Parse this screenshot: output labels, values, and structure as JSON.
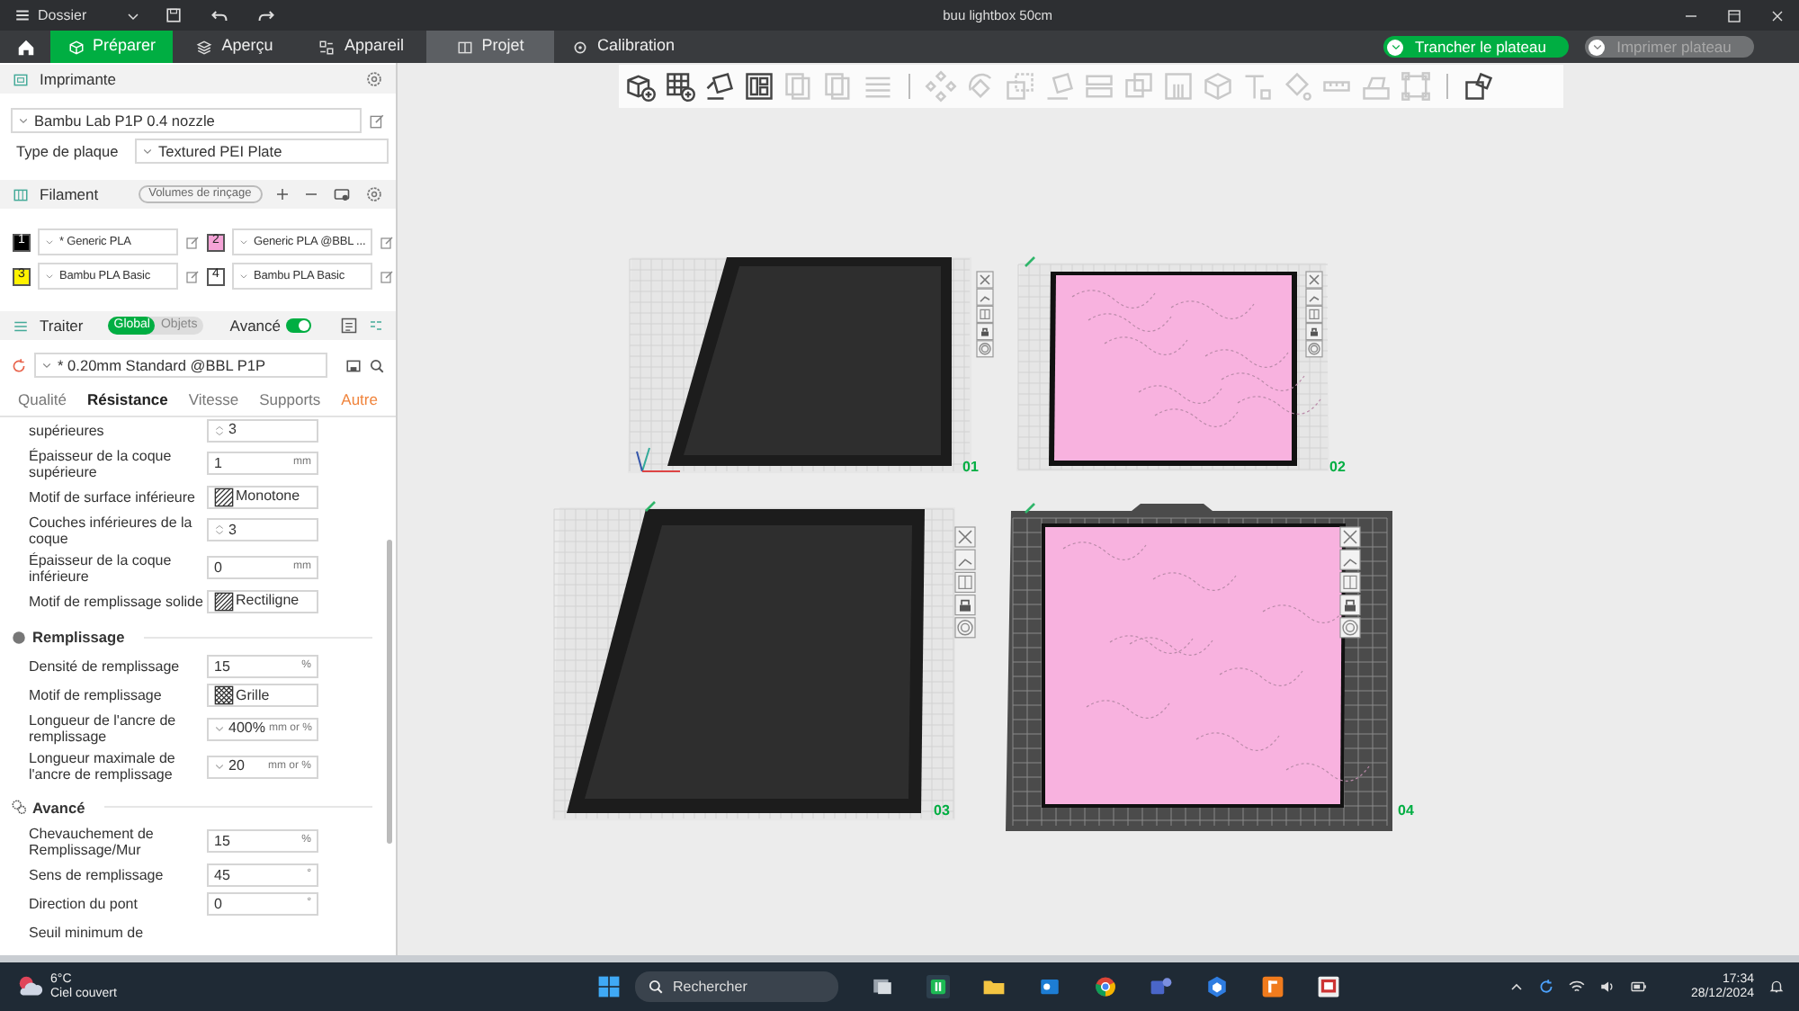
{
  "window": {
    "menu": "Dossier",
    "title": "buu lightbox 50cm"
  },
  "tabs": [
    {
      "label": "Préparer",
      "selected": true,
      "hovered": false
    },
    {
      "label": "Aperçu",
      "selected": false,
      "hovered": false
    },
    {
      "label": "Appareil",
      "selected": false,
      "hovered": false
    },
    {
      "label": "Projet",
      "selected": false,
      "hovered": true
    },
    {
      "label": "Calibration",
      "selected": false,
      "hovered": false
    }
  ],
  "actions": [
    {
      "label": "Trancher le plateau",
      "disabled": false
    },
    {
      "label": "Imprimer plateau",
      "disabled": true
    }
  ],
  "printer": {
    "title": "Imprimante",
    "model": "Bambu Lab P1P 0.4 nozzle",
    "plate_type_label": "Type de plaque",
    "plate_type": "Textured PEI Plate"
  },
  "filament": {
    "title": "Filament",
    "flush_button": "Volumes de rinçage",
    "items": [
      {
        "number": "1",
        "color": "#000000",
        "name": "* Generic PLA"
      },
      {
        "number": "2",
        "color": "#f5a3d7",
        "name": "Generic PLA @BBL ..."
      },
      {
        "number": "3",
        "color": "#fff200",
        "name": "Bambu PLA Basic"
      },
      {
        "number": "4",
        "color": "#ffffff",
        "name": "Bambu PLA Basic"
      }
    ]
  },
  "process": {
    "title": "Traiter",
    "scopes": [
      {
        "label": "Global",
        "selected": true
      },
      {
        "label": "Objets",
        "selected": false
      }
    ],
    "advanced": {
      "label": "Avancé",
      "on": true
    },
    "preset": "* 0.20mm Standard @BBL P1P",
    "tabs": [
      {
        "label": "Qualité",
        "selected": false,
        "modified": false
      },
      {
        "label": "Résistance",
        "selected": true,
        "modified": false
      },
      {
        "label": "Vitesse",
        "selected": false,
        "modified": false
      },
      {
        "label": "Supports",
        "selected": false,
        "modified": false
      },
      {
        "label": "Autre",
        "selected": false,
        "modified": true
      }
    ]
  },
  "settings": [
    {
      "kind": "spin",
      "label": "supérieures",
      "value": "3"
    },
    {
      "kind": "number",
      "label": "Épaisseur de la coque supérieure",
      "value": "1",
      "unit": "mm"
    },
    {
      "kind": "pattern",
      "label": "Motif de surface inférieure",
      "value": "Monotone"
    },
    {
      "kind": "spin",
      "label": "Couches inférieures de la coque",
      "value": "3"
    },
    {
      "kind": "number",
      "label": "Épaisseur de la coque inférieure",
      "value": "0",
      "unit": "mm"
    },
    {
      "kind": "pattern",
      "label": "Motif de remplissage solide",
      "value": "Rectiligne"
    },
    {
      "kind": "section",
      "title": "Remplissage"
    },
    {
      "kind": "number",
      "label": "Densité de remplissage",
      "value": "15",
      "unit": "%"
    },
    {
      "kind": "pattern",
      "label": "Motif de remplissage",
      "value": "Grille"
    },
    {
      "kind": "combo",
      "label": "Longueur de l'ancre de remplissage",
      "value": "400%",
      "unit": "mm or %"
    },
    {
      "kind": "combo",
      "label": "Longueur maximale de l'ancre de remplissage",
      "value": "20",
      "unit": "mm or %"
    },
    {
      "kind": "section",
      "title": "Avancé"
    },
    {
      "kind": "number",
      "label": "Chevauchement de Remplissage/Mur",
      "value": "15",
      "unit": "%"
    },
    {
      "kind": "number",
      "label": "Sens de remplissage",
      "value": "45",
      "unit": "°"
    },
    {
      "kind": "number",
      "label": "Direction du pont",
      "value": "0",
      "unit": "°"
    },
    {
      "kind": "label",
      "label": "Seuil minimum de"
    }
  ],
  "toolbar": [
    {
      "kind": "tool",
      "disabled": false
    },
    {
      "kind": "tool",
      "disabled": false
    },
    {
      "kind": "tool",
      "disabled": false
    },
    {
      "kind": "tool",
      "disabled": false
    },
    {
      "kind": "tool",
      "disabled": true
    },
    {
      "kind": "tool",
      "disabled": true
    },
    {
      "kind": "tool",
      "disabled": true
    },
    {
      "kind": "separator"
    },
    {
      "kind": "tool",
      "disabled": true
    },
    {
      "kind": "tool",
      "disabled": true
    },
    {
      "kind": "tool",
      "disabled": true
    },
    {
      "kind": "tool",
      "disabled": true
    },
    {
      "kind": "tool",
      "disabled": true
    },
    {
      "kind": "tool",
      "disabled": true
    },
    {
      "kind": "tool",
      "disabled": true
    },
    {
      "kind": "tool",
      "disabled": true
    },
    {
      "kind": "tool",
      "disabled": true
    },
    {
      "kind": "tool",
      "disabled": true
    },
    {
      "kind": "tool",
      "disabled": true
    },
    {
      "kind": "tool",
      "disabled": true
    },
    {
      "kind": "tool",
      "disabled": true
    },
    {
      "kind": "separator"
    },
    {
      "kind": "tool",
      "disabled": false
    }
  ],
  "plates": [
    {
      "number": "01",
      "kind": "tray",
      "selected": false
    },
    {
      "number": "02",
      "kind": "panel",
      "selected": false
    },
    {
      "number": "03",
      "kind": "tray",
      "selected": false
    },
    {
      "number": "04",
      "kind": "panel",
      "selected": true
    }
  ],
  "taskbar": {
    "temperature": "6°C",
    "weather": "Ciel couvert",
    "search_placeholder": "Rechercher",
    "time": "17:34",
    "date": "28/12/2024"
  }
}
